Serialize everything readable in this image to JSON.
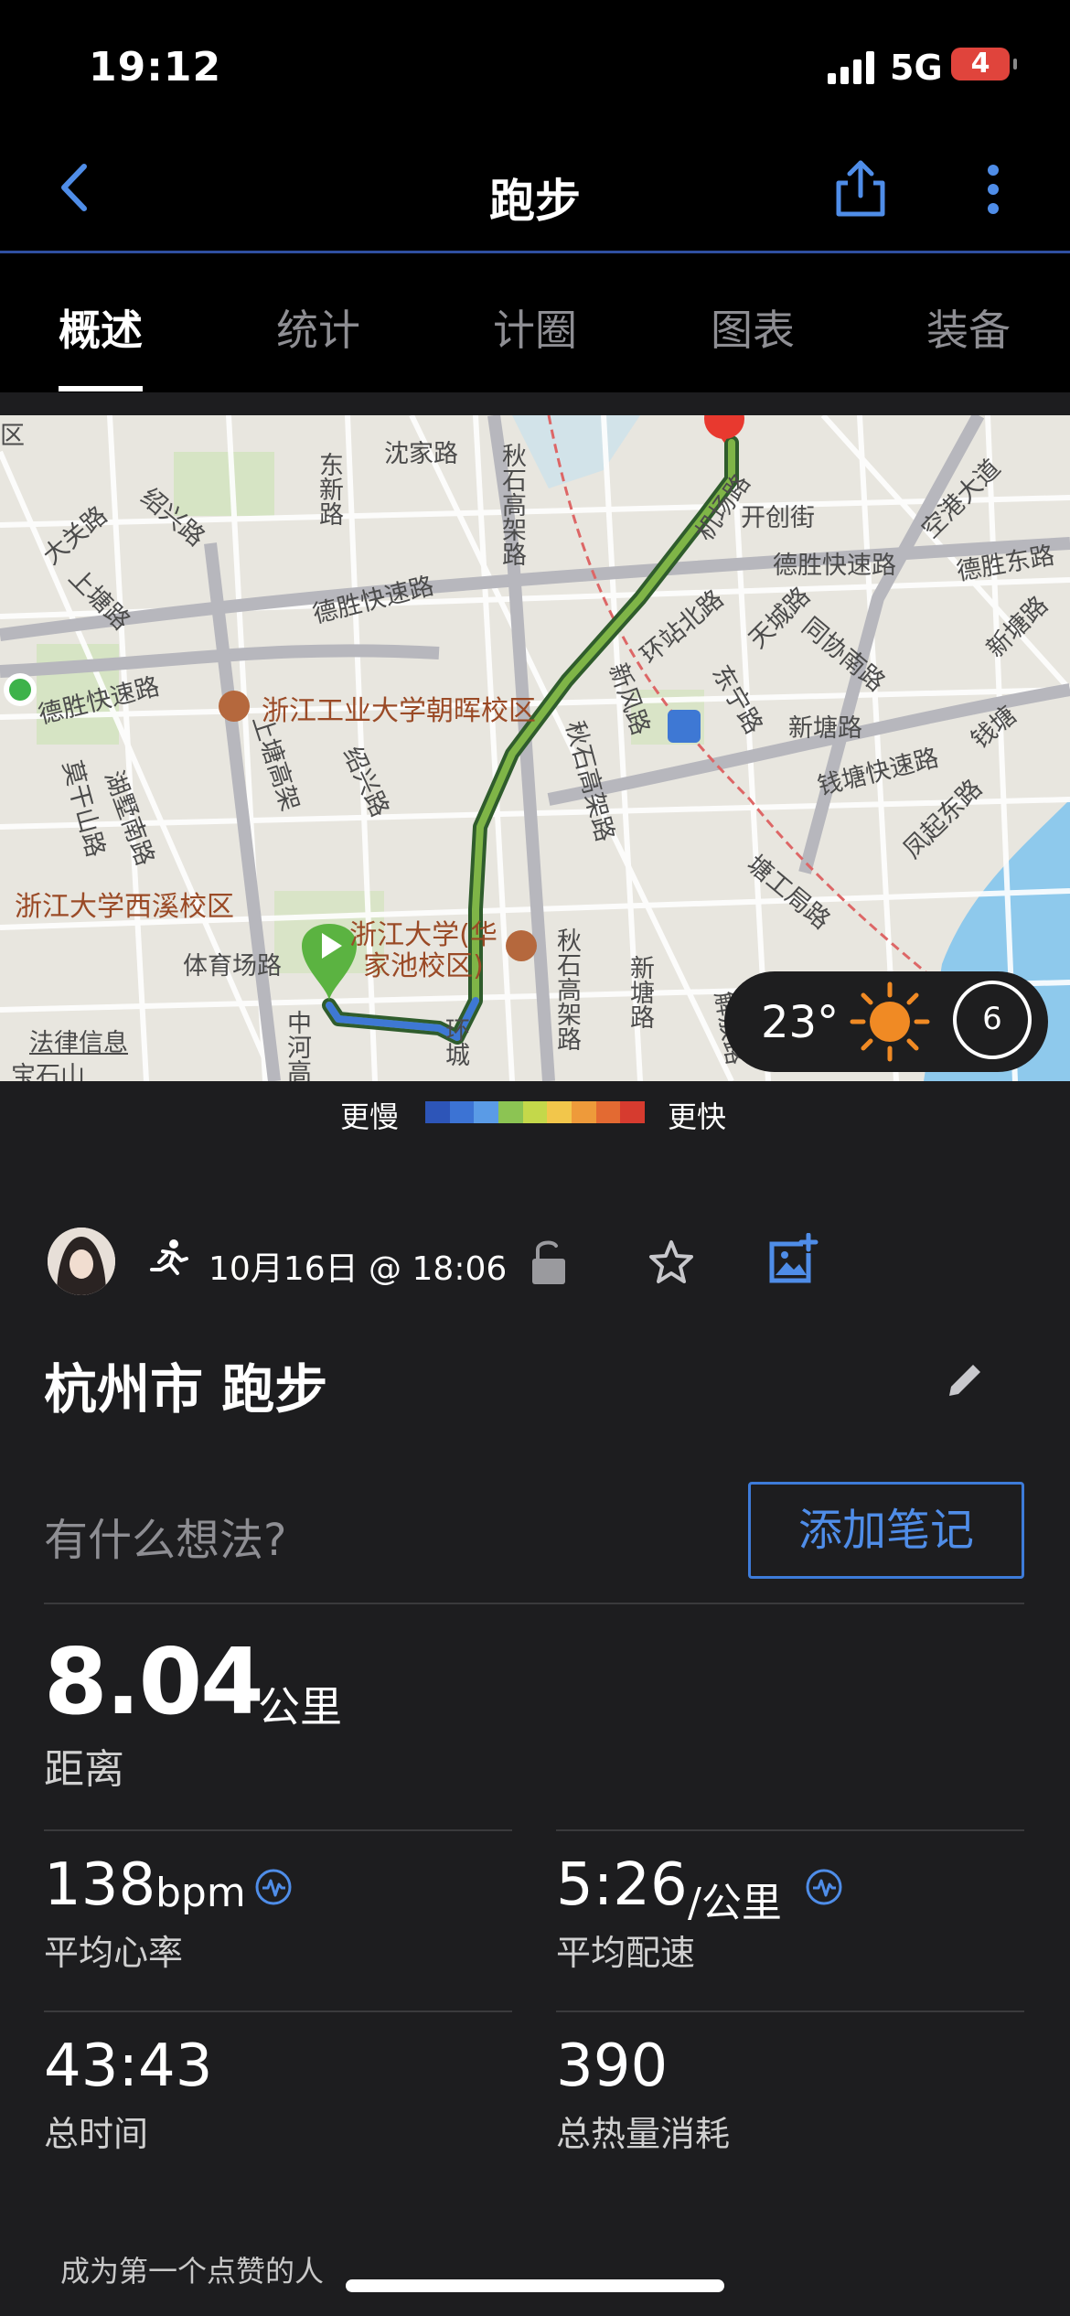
{
  "status_bar": {
    "time": "19:12",
    "network": "5G",
    "battery": "4"
  },
  "navbar": {
    "title": "跑步",
    "back_icon": "chevron-left-icon",
    "share_icon": "share-icon",
    "more_icon": "more-vertical-icon"
  },
  "tabs": [
    "概述",
    "统计",
    "计圈",
    "图表",
    "装备"
  ],
  "active_tab": "概述",
  "map": {
    "labels": {
      "district": "区",
      "shenjia": "沈家路",
      "qiushi1": "秋石高架路",
      "dongxin": "东新路",
      "shaoxing1": "绍兴路",
      "daguan": "大关路",
      "shangtang1": "上塘路",
      "desheng1": "德胜快速路",
      "jichang": "机场路",
      "kaichuang": "开创街",
      "desheng2": "德胜快速路",
      "deshengdong": "德胜东路",
      "konggang": "空港大道",
      "huanzhanbei": "环站北路",
      "tiancheng": "天城路",
      "tongxie": "同协南路",
      "xintang1": "新塘路",
      "desheng3": "德胜快速路",
      "shangtang2": "上塘高架",
      "xinfeng": "新风路",
      "dongning": "东宁路",
      "xintang2": "新塘路",
      "qiantang": "钱塘快速路",
      "qiantang2": "钱塘",
      "shaoxing2": "绍兴路",
      "qiushi2": "秋石高架路",
      "fengqi": "凤起东路",
      "huzhou": "湖墅南路",
      "mogan": "莫干山路",
      "tangong": "塘工局路",
      "tiyuchang": "体育场路",
      "qiushi3": "秋石高架路",
      "xintang3": "新塘路",
      "zhonghe": "中河高",
      "huancheng": "环城",
      "jiefang": "解放路",
      "legal": "法律信息",
      "baoshi": "宝石山",
      "poi_zjut": "浙江工业大学朝晖校区",
      "poi_zju_xixi": "浙江大学西溪校区",
      "poi_zju_hua": "浙江大学(华家池校区)"
    },
    "weather": {
      "temperature": "23°",
      "icon": "sun-icon",
      "moon_phase": "6"
    }
  },
  "pace_legend": {
    "slow": "更慢",
    "fast": "更快",
    "colors": [
      "#2d55b8",
      "#3c73d4",
      "#5a9be6",
      "#8cc453",
      "#c4d84a",
      "#f2c64b",
      "#ee9a3a",
      "#e36a32",
      "#d63b2f"
    ]
  },
  "activity": {
    "date": "10月16日 @ 18:06",
    "title": "杭州市 跑步",
    "thoughts_placeholder": "有什么想法?",
    "add_note": "添加笔记",
    "distance": {
      "value": "8.04",
      "unit": "公里",
      "label": "距离"
    },
    "stats": [
      {
        "value": "138",
        "unit": "bpm",
        "label": "平均心率"
      },
      {
        "value": "5:26",
        "unit": "/公里",
        "label": "平均配速"
      },
      {
        "value": "43:43",
        "unit": "",
        "label": "总时间"
      },
      {
        "value": "390",
        "unit": "",
        "label": "总热量消耗"
      }
    ],
    "likes": "成为第一个点赞的人"
  },
  "colors": {
    "accent": "#4f8de8",
    "route": "#3b7a3a",
    "start_marker": "#5bb341",
    "end_marker": "#e8392f"
  }
}
